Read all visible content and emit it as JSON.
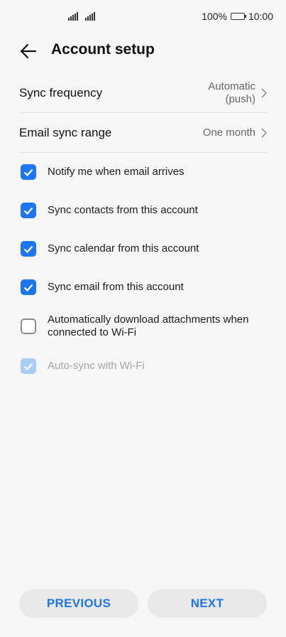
{
  "status_bar": {
    "battery": "100%",
    "time": "10:00"
  },
  "header": {
    "title": "Account setup"
  },
  "settings": [
    {
      "label": "Sync frequency",
      "value_line1": "Automatic",
      "value_line2": "(push)"
    },
    {
      "label": "Email sync range",
      "value_line1": "One month"
    }
  ],
  "checkboxes": [
    {
      "label": "Notify me when email arrives",
      "checked": true
    },
    {
      "label": "Sync contacts from this account",
      "checked": true
    },
    {
      "label": "Sync calendar from this account",
      "checked": true
    },
    {
      "label": "Sync email from this account",
      "checked": true
    },
    {
      "label": "Automatically download attachments when connected to Wi-Fi",
      "checked": false
    },
    {
      "label": "Auto-sync with Wi-Fi",
      "checked": true,
      "disabled": true
    }
  ],
  "buttons": {
    "previous": "PREVIOUS",
    "next": "NEXT"
  },
  "colors": {
    "accent": "#1e75f0",
    "accent_disabled": "#a9cdf9",
    "background": "#f6f6f6"
  }
}
